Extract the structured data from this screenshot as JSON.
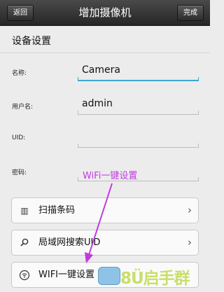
{
  "header": {
    "back_label": "返回",
    "title": "增加摄像机",
    "done_label": "完成"
  },
  "section": {
    "title": "设备设置"
  },
  "fields": [
    {
      "label": "名称:",
      "value": "Camera"
    },
    {
      "label": "用户名:",
      "value": "admin"
    },
    {
      "label": "UID:",
      "value": ""
    },
    {
      "label": "密码:",
      "value": ""
    }
  ],
  "actions": [
    {
      "icon": "barcode-icon",
      "label": "扫描条码"
    },
    {
      "icon": "search-icon",
      "label": "局域网搜索UID"
    },
    {
      "icon": "wifi-icon",
      "label": "WIFI一键设置"
    }
  ],
  "annotation": {
    "text": "WiFi一键设置",
    "color": "#c03be0"
  },
  "watermark": {
    "text": "8Ü启手群"
  }
}
